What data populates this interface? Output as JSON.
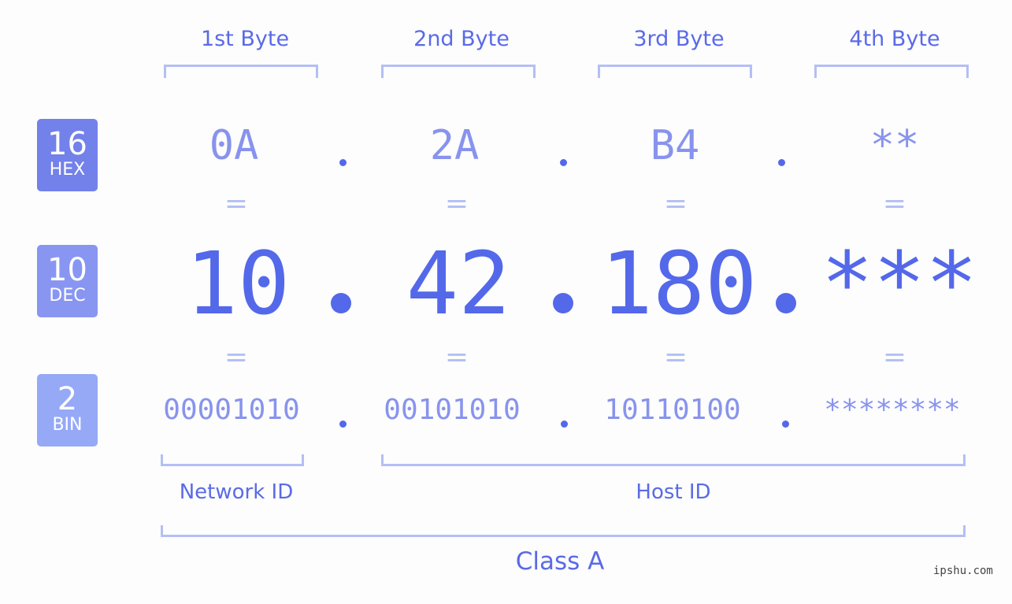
{
  "headers": [
    "1st Byte",
    "2nd Byte",
    "3rd Byte",
    "4th Byte"
  ],
  "badges": {
    "hex": {
      "num": "16",
      "label": "HEX",
      "color": "#7381ea"
    },
    "dec": {
      "num": "10",
      "label": "DEC",
      "color": "#8896f2"
    },
    "bin": {
      "num": "2",
      "label": "BIN",
      "color": "#96a9f7"
    }
  },
  "hex": [
    "0A",
    "2A",
    "B4",
    "**"
  ],
  "dec": [
    "10",
    "42",
    "180",
    "***"
  ],
  "bin": [
    "00001010",
    "00101010",
    "10110100",
    "********"
  ],
  "equals": "=",
  "labels": {
    "network": "Network ID",
    "host": "Host ID",
    "class": "Class A"
  },
  "watermark": "ipshu.com"
}
